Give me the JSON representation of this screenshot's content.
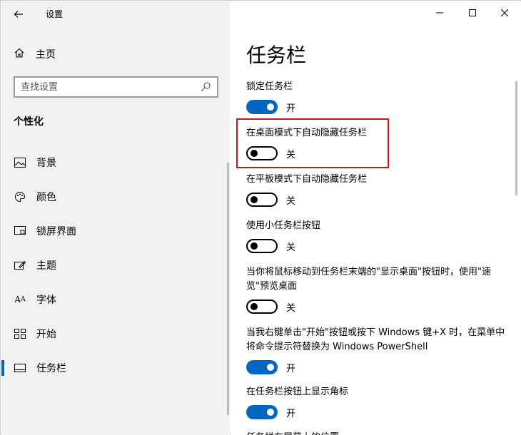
{
  "window": {
    "title": "设置"
  },
  "sidebar": {
    "home_label": "主页",
    "search_placeholder": "查找设置",
    "section_title": "个性化",
    "items": [
      {
        "label": "背景",
        "icon": "image-icon"
      },
      {
        "label": "颜色",
        "icon": "palette-icon"
      },
      {
        "label": "锁屏界面",
        "icon": "lock-screen-icon"
      },
      {
        "label": "主题",
        "icon": "theme-icon"
      },
      {
        "label": "字体",
        "icon": "font-icon"
      },
      {
        "label": "开始",
        "icon": "start-icon"
      },
      {
        "label": "任务栏",
        "icon": "taskbar-icon",
        "active": true
      }
    ]
  },
  "main": {
    "title": "任务栏",
    "settings": [
      {
        "label": "锁定任务栏",
        "state": "开",
        "on": true
      },
      {
        "label": "在桌面模式下自动隐藏任务栏",
        "state": "关",
        "on": false
      },
      {
        "label": "在平板模式下自动隐藏任务栏",
        "state": "关",
        "on": false
      },
      {
        "label": "使用小任务栏按钮",
        "state": "关",
        "on": false
      },
      {
        "label": "当你将鼠标移动到任务栏末端的\"显示桌面\"按钮时，使用\"速览\"预览桌面",
        "state": "关",
        "on": false
      },
      {
        "label": "当我右键单击\"开始\"按钮或按下 Windows 键+X 时，在菜单中将命令提示符替换为 Windows PowerShell",
        "state": "开",
        "on": true
      },
      {
        "label": "在任务栏按钮上显示角标",
        "state": "开",
        "on": true
      }
    ],
    "cutoff_text": "任务栏在屏幕上的位置"
  },
  "colors": {
    "accent": "#0067c0",
    "highlight": "#d0121c"
  }
}
